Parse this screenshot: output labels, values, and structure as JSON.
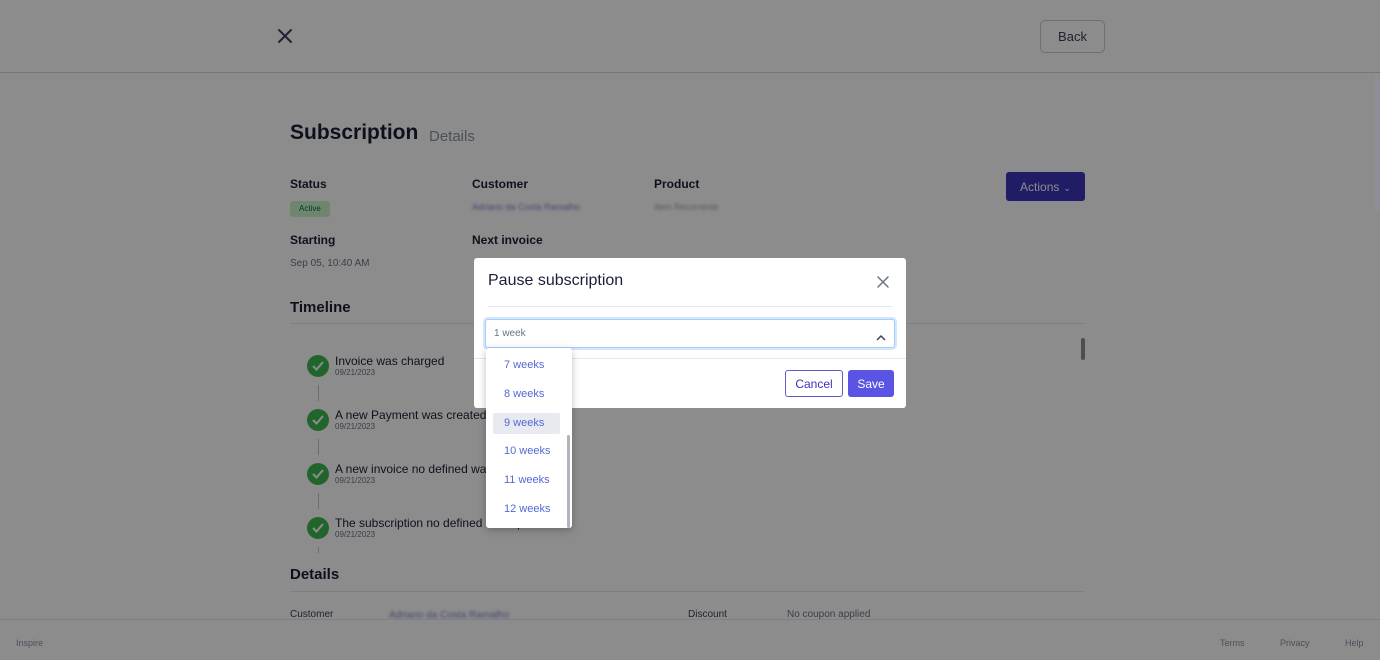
{
  "header": {
    "back_label": "Back"
  },
  "page": {
    "title": "Subscription",
    "subtitle": "Details"
  },
  "summary": {
    "status_label": "Status",
    "status_badge": "Active",
    "customer_label": "Customer",
    "customer_value": "Adriano da Costa Ramalho",
    "product_label": "Product",
    "product_value": "Item Recorrente",
    "starting_label": "Starting",
    "starting_value": "Sep 05, 10:40 AM",
    "next_invoice_label": "Next invoice",
    "actions_label": "Actions"
  },
  "timeline": {
    "title": "Timeline",
    "items": [
      {
        "text": "Invoice was charged",
        "date": "09/21/2023"
      },
      {
        "text": "A new Payment was created",
        "date": "09/21/2023"
      },
      {
        "text": "A new invoice no defined was created",
        "date": "09/21/2023"
      },
      {
        "text": "The subscription no defined was updated",
        "date": "09/21/2023"
      }
    ]
  },
  "details": {
    "title": "Details",
    "customer_label": "Customer",
    "customer_value": "Adriano da Costa Ramalho",
    "discount_label": "Discount",
    "discount_value": "No coupon applied"
  },
  "footer": {
    "brand": "Inspire",
    "terms": "Terms",
    "privacy": "Privacy",
    "help": "Help"
  },
  "modal": {
    "title": "Pause subscription",
    "select_value": "1 week",
    "cancel_label": "Cancel",
    "save_label": "Save",
    "dropdown_options": [
      "7 weeks",
      "8 weeks",
      "9 weeks",
      "10 weeks",
      "11 weeks",
      "12 weeks"
    ],
    "hovered_option": "9 weeks"
  },
  "colors": {
    "primary": "#3b33b8",
    "save_button": "#5a54e4",
    "success": "#3fb950",
    "badge_bg": "#cbf4c9",
    "link": "#5469d4"
  }
}
